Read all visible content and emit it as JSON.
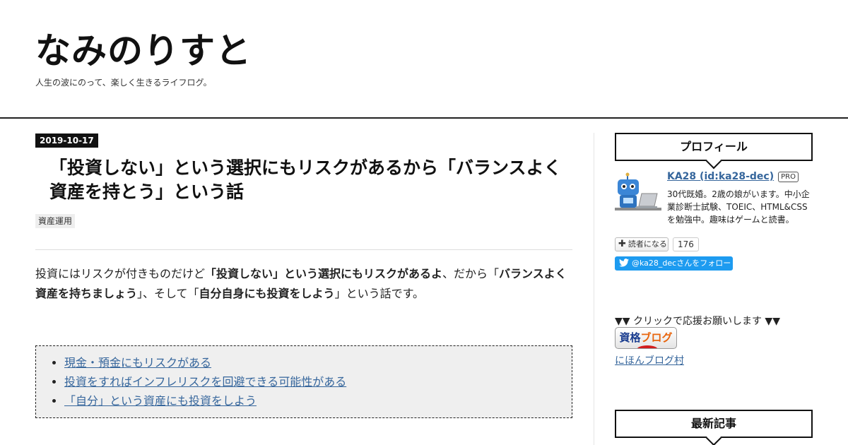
{
  "header": {
    "blog_title": "なみのりすと",
    "blog_desc": "人生の波にのって、楽しく生きるライフログ。"
  },
  "entry": {
    "date": "2019-10-17",
    "title": "「投資しない」という選択にもリスクがあるから「バランスよく資産を持とう」という話",
    "category": "資産運用",
    "lead": [
      {
        "text": "投資にはリスクが付きものだけど",
        "bold": false
      },
      {
        "text": "「投資しない」という選択にもリスクがあるよ",
        "bold": true
      },
      {
        "text": "、だから「",
        "bold": false
      },
      {
        "text": "バランスよく資産を持ちましょう",
        "bold": true
      },
      {
        "text": "」、そして「",
        "bold": false
      },
      {
        "text": "自分自身にも投資をしよう",
        "bold": true
      },
      {
        "text": "」という話です。",
        "bold": false
      }
    ],
    "toc": [
      "現金・預金にもリスクがある",
      "投資をすればインフレリスクを回避できる可能性がある",
      "「自分」という資産にも投資をしよう"
    ]
  },
  "sidebar": {
    "profile_heading": "プロフィール",
    "profile_name": "KA28 (id:ka28-dec)",
    "pro_badge": "PRO",
    "profile_desc": "30代既婚。2歳の娘がいます。中小企業診断士試験、TOEIC、HTML&CSSを勉強中。趣味はゲームと読書。",
    "reader_button": "読者になる",
    "reader_count": "176",
    "twitter_follow": "@ka28_decさんをフォロー",
    "click_text": "▼▼ クリックで応援お願いします ▼▼",
    "banner_part1": "資格",
    "banner_part2": "ブログ",
    "nihon_link": "にほんブログ村",
    "recent_heading": "最新記事"
  },
  "colors": {
    "link": "#36669c",
    "twitter": "#1d9bf0",
    "toc_bg": "#efefef",
    "date_badge_bg": "#111111"
  },
  "icons": [
    "robot-avatar-icon",
    "plus-icon",
    "twitter-bird-icon"
  ]
}
